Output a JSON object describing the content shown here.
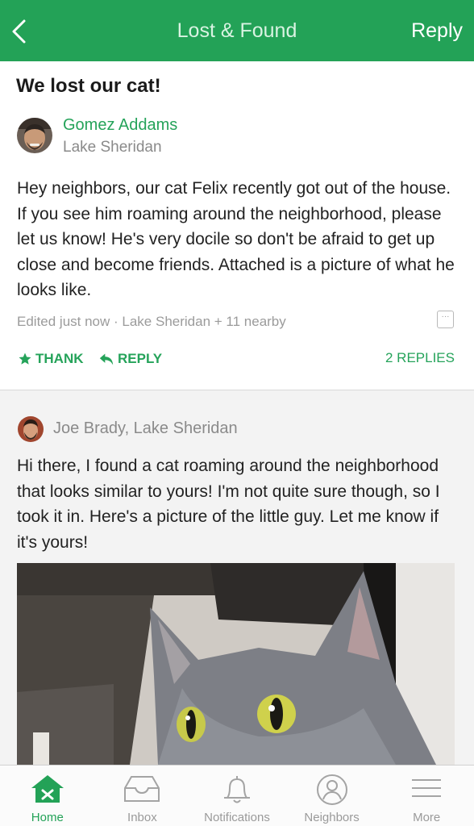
{
  "nav": {
    "title": "Lost & Found",
    "reply_label": "Reply",
    "back_icon": "chevron-left-icon"
  },
  "post": {
    "title": "We lost our cat!",
    "author": {
      "name": "Gomez Addams",
      "location": "Lake Sheridan"
    },
    "body": "Hey neighbors, our cat Felix recently got out of the house. If you see him roaming around the neighborhood, please let us know! He's very docile so don't be afraid to get up close and become friends. Attached is a picture of what he looks like.",
    "meta": "Edited just now · Lake Sheridan + 11 nearby",
    "more_glyph": "···",
    "actions": {
      "thank_label": "THANK",
      "reply_label": "REPLY",
      "replies_count_label": "2 REPLIES"
    }
  },
  "reply": {
    "author_line": "Joe Brady, Lake Sheridan",
    "body": "Hi there, I found a cat roaming around the neighborhood that looks similar to yours! I'm not quite sure though, so I took it in. Here's a picture of the little guy. Let me know if it's yours!"
  },
  "tabbar": {
    "tabs": [
      {
        "label": "Home",
        "icon": "home-icon",
        "active": true
      },
      {
        "label": "Inbox",
        "icon": "inbox-icon",
        "active": false
      },
      {
        "label": "Notifications",
        "icon": "bell-icon",
        "active": false
      },
      {
        "label": "Neighbors",
        "icon": "person-icon",
        "active": false
      },
      {
        "label": "More",
        "icon": "menu-icon",
        "active": false
      }
    ]
  },
  "colors": {
    "brand_green": "#23a257",
    "link_green": "#25a35a",
    "meta_gray": "#9b9b9b",
    "reply_bg": "#f3f3f3"
  }
}
